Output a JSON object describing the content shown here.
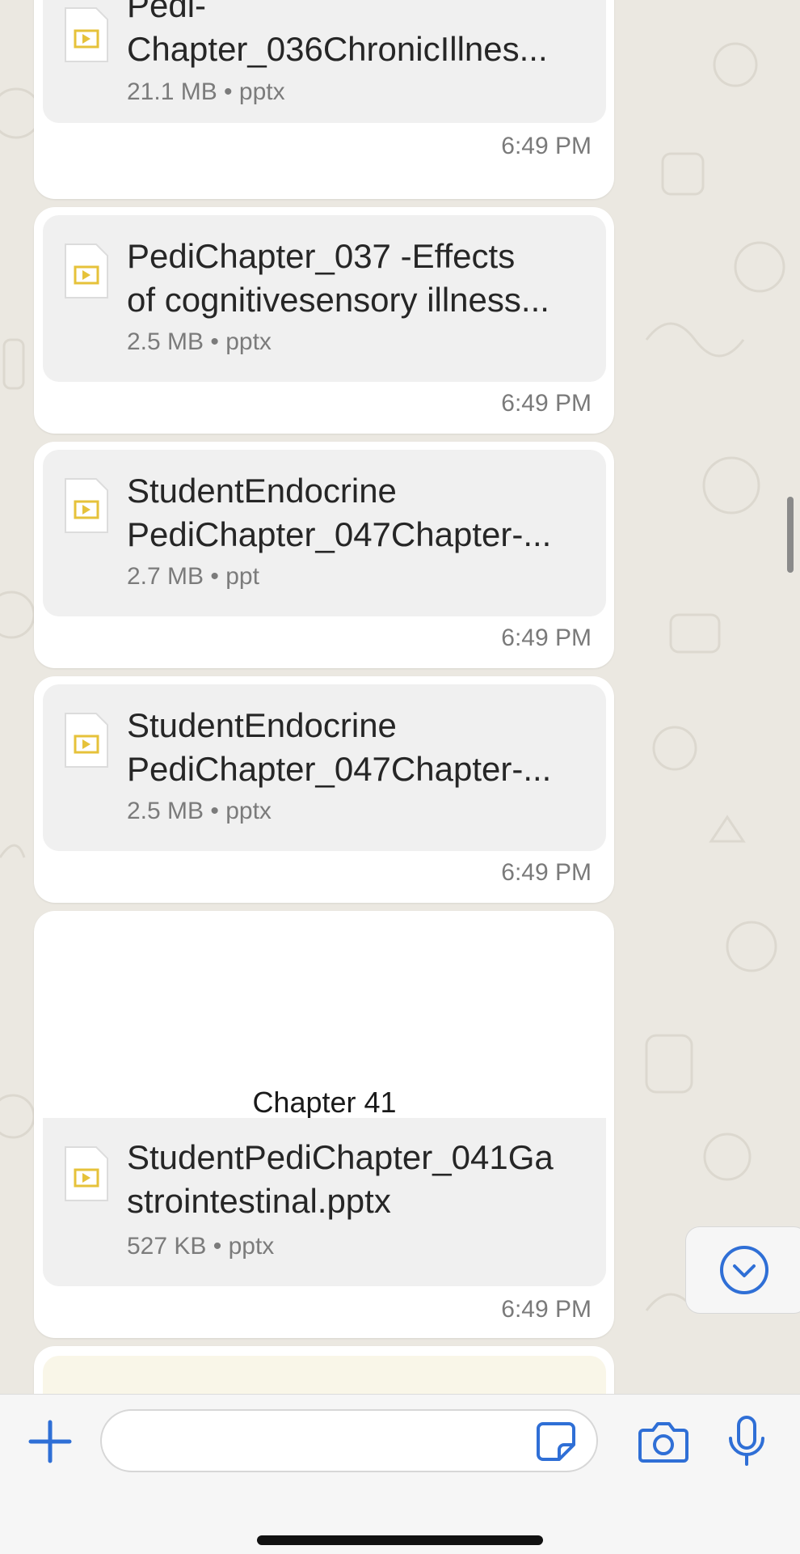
{
  "messages": [
    {
      "file_name_line1": "Pedi-",
      "file_name_line2": "Chapter_036ChronicIllnes...",
      "meta": "21.1 MB • pptx",
      "time": "6:49 PM"
    },
    {
      "file_name_line1": "PediChapter_037 -Effects",
      "file_name_line2": "of cognitivesensory illness...",
      "meta": "2.5 MB • pptx",
      "time": "6:49 PM"
    },
    {
      "file_name_line1": "StudentEndocrine",
      "file_name_line2": "PediChapter_047Chapter-...",
      "meta": "2.7 MB • ppt",
      "time": "6:49 PM"
    },
    {
      "file_name_line1": "StudentEndocrine",
      "file_name_line2": "PediChapter_047Chapter-...",
      "meta": "2.5 MB • pptx",
      "time": "6:49 PM"
    },
    {
      "preview_text": "Chapter 41",
      "file_name_line1": "StudentPediChapter_041Ga",
      "file_name_line2": "strointestinal.pptx",
      "meta": "527 KB • pptx",
      "time": "6:49 PM"
    }
  ],
  "input": {
    "placeholder": ""
  },
  "icons": {
    "file": "presentation-file-icon",
    "scroll_down": "chevron-down-circle-icon",
    "attach": "plus-icon",
    "sticker": "sticker-icon",
    "camera": "camera-icon",
    "mic": "microphone-icon"
  },
  "colors": {
    "accent": "#2f6fd6",
    "file_icon": "#e6c23a",
    "chat_bg": "#ebe8e1"
  }
}
